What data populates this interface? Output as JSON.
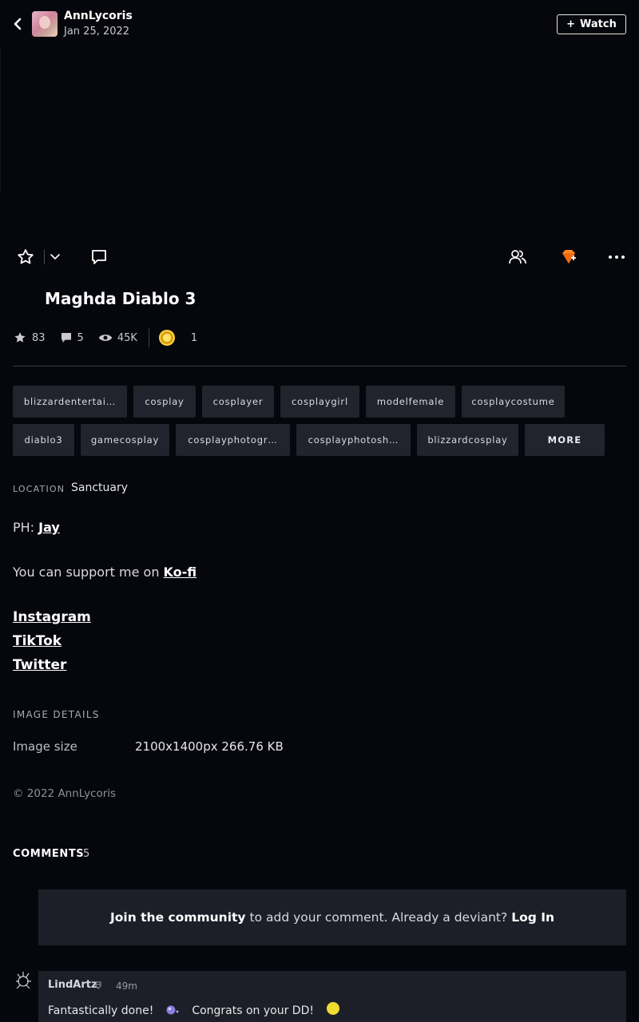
{
  "header": {
    "author": "AnnLycoris",
    "date": "Jan 25, 2022",
    "watch_label": "Watch",
    "watch_prefix": "+"
  },
  "deviation": {
    "title": "Maghda Diablo 3",
    "stats": {
      "favourites": "83",
      "comments": "5",
      "views": "45K",
      "awards": "1"
    }
  },
  "tags": [
    "blizzardentertai…",
    "cosplay",
    "cosplayer",
    "cosplaygirl",
    "modelfemale",
    "cosplaycostume",
    "diablo3",
    "gamecosplay",
    "cosplayphotogr…",
    "cosplayphotosh…",
    "blizzardcosplay"
  ],
  "tags_more_label": "MORE",
  "location": {
    "label": "LOCATION",
    "value": "Sanctuary"
  },
  "description": {
    "ph_prefix": "PH:",
    "ph_link": "Jay",
    "support_text": "You can support me on",
    "support_link": "Ko-fi",
    "social_links": [
      "Instagram",
      "TikTok",
      "Twitter"
    ]
  },
  "image_details": {
    "section_label": "IMAGE DETAILS",
    "size_key": "Image size",
    "size_value": "2100x1400px 266.76 KB"
  },
  "copyright": "© 2022 AnnLycoris",
  "comments": {
    "heading": "COMMENTS",
    "count": "5",
    "join_link": "Join the community",
    "join_text": "to add your comment. Already a deviant?",
    "login_link": "Log In",
    "items": [
      {
        "user": "LindArtz",
        "time": "49m",
        "text_a": "Fantastically done!",
        "text_b": "Congrats on your DD!"
      }
    ]
  },
  "colors": {
    "background": "#06070d",
    "panel": "#1d1f28",
    "tag_bg": "#22232c",
    "gem_orange": "#ff8a1f",
    "coin_gold": "#ffd23f"
  },
  "icons": [
    "chevron-left-icon",
    "star-icon",
    "chevron-down-icon",
    "comment-icon",
    "watchers-icon",
    "gem-icon",
    "more-icon",
    "eye-icon",
    "coin-icon"
  ]
}
